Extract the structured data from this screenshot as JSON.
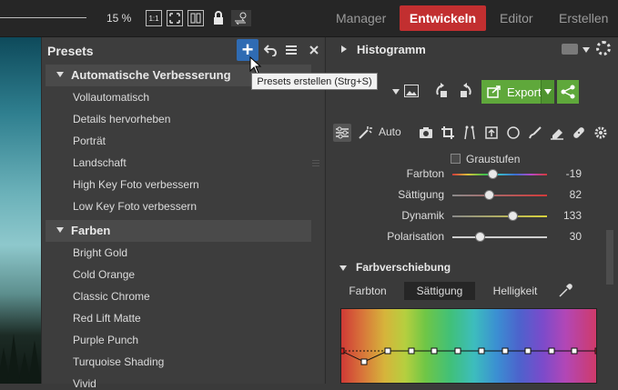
{
  "toolbar": {
    "zoom": "15 %",
    "icons": [
      "zoom-1to1-icon",
      "fit-icon",
      "compare-icon",
      "lock-icon",
      "swap-icon"
    ]
  },
  "modes": {
    "manager": "Manager",
    "develop": "Entwickeln",
    "editor": "Editor",
    "create": "Erstellen"
  },
  "presets": {
    "title": "Presets",
    "tooltip": "Presets erstellen (Strg+S)",
    "groups": [
      {
        "label": "Automatische Verbesserung",
        "items": [
          "Vollautomatisch",
          "Details hervorheben",
          "Porträt",
          "Landschaft",
          "High Key Foto verbessern",
          "Low Key Foto verbessern"
        ]
      },
      {
        "label": "Farben",
        "items": [
          "Bright Gold",
          "Cold Orange",
          "Classic Chrome",
          "Red Lift Matte",
          "Purple Punch",
          "Turquoise Shading",
          "Vivid"
        ]
      }
    ]
  },
  "right": {
    "histogram_title": "Histogramm",
    "export_label": "Export",
    "auto_label": "Auto",
    "grayscale_label": "Graustufen",
    "sliders": [
      {
        "label": "Farbton",
        "value": "-19",
        "pos": 0.42
      },
      {
        "label": "Sättigung",
        "value": "82",
        "pos": 0.38
      },
      {
        "label": "Dynamik",
        "value": "133",
        "pos": 0.63
      },
      {
        "label": "Polarisation",
        "value": "30",
        "pos": 0.29
      }
    ],
    "section_title": "Farbverschiebung",
    "tabs": [
      "Farbton",
      "Sättigung",
      "Helligkeit"
    ],
    "active_tab": "Sättigung",
    "colors": {
      "accent_red": "#c22f30",
      "export_green": "#5fa83b",
      "add_blue": "#2f6bb3"
    }
  }
}
